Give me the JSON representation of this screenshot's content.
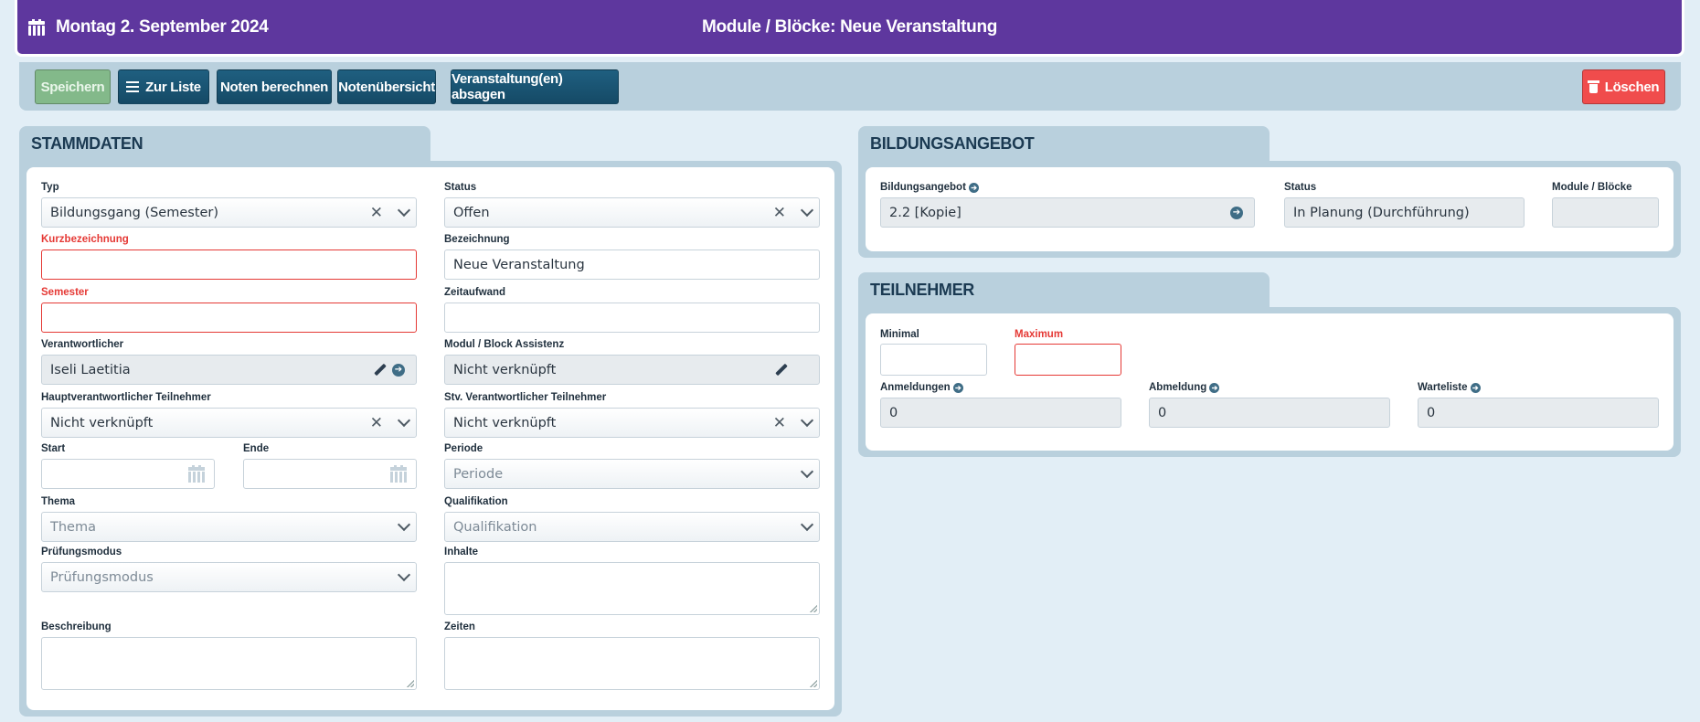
{
  "header": {
    "date": "Montag 2. September 2024",
    "title": "Module / Blöcke: Neue Veranstaltung"
  },
  "toolbar": {
    "save": "Speichern",
    "to_list": "Zur Liste",
    "calc_grades": "Noten berechnen",
    "grade_overview": "Notenübersicht",
    "cancel_events": "Veranstaltung(en) absagen",
    "delete": "Löschen"
  },
  "colors": {
    "header_bg": "#5e379e",
    "toolbar_bg": "#b9d0dd",
    "button_dark": "#1a5575",
    "button_save": "#83b98a",
    "button_delete": "#f04c4c",
    "required_red": "#e53935"
  },
  "stammdaten": {
    "title": "STAMMDATEN",
    "typ_label": "Typ",
    "typ_value": "Bildungsgang (Semester)",
    "status_label": "Status",
    "status_value": "Offen",
    "kurz_label": "Kurzbezeichnung",
    "kurz_value": "",
    "bezeichnung_label": "Bezeichnung",
    "bezeichnung_value": "Neue Veranstaltung",
    "semester_label": "Semester",
    "semester_value": "",
    "zeitaufwand_label": "Zeitaufwand",
    "zeitaufwand_value": "",
    "verantwortlicher_label": "Verantwortlicher",
    "verantwortlicher_value": "Iseli Laetitia",
    "assistenz_label": "Modul / Block Assistenz",
    "assistenz_value": "Nicht verknüpft",
    "hauptverantw_label": "Hauptverantwortlicher Teilnehmer",
    "hauptverantw_value": "Nicht verknüpft",
    "stv_label": "Stv. Verantwortlicher Teilnehmer",
    "stv_value": "Nicht verknüpft",
    "start_label": "Start",
    "ende_label": "Ende",
    "periode_label": "Periode",
    "periode_placeholder": "Periode",
    "thema_label": "Thema",
    "thema_placeholder": "Thema",
    "qualifikation_label": "Qualifikation",
    "qualifikation_placeholder": "Qualifikation",
    "pruefungsmodus_label": "Prüfungsmodus",
    "pruefungsmodus_placeholder": "Prüfungsmodus",
    "inhalte_label": "Inhalte",
    "beschreibung_label": "Beschreibung",
    "zeiten_label": "Zeiten"
  },
  "bildungsangebot": {
    "title": "BILDUNGSANGEBOT",
    "angebot_label": "Bildungsangebot",
    "angebot_value": "2.2 [Kopie]",
    "status_label": "Status",
    "status_value": "In Planung (Durchführung)",
    "module_label": "Module / Blöcke",
    "module_value": ""
  },
  "teilnehmer": {
    "title": "TEILNEHMER",
    "minimal_label": "Minimal",
    "minimal_value": "",
    "maximum_label": "Maximum",
    "maximum_value": "",
    "anmeldungen_label": "Anmeldungen",
    "anmeldungen_value": "0",
    "abmeldung_label": "Abmeldung",
    "abmeldung_value": "0",
    "warteliste_label": "Warteliste",
    "warteliste_value": "0"
  }
}
